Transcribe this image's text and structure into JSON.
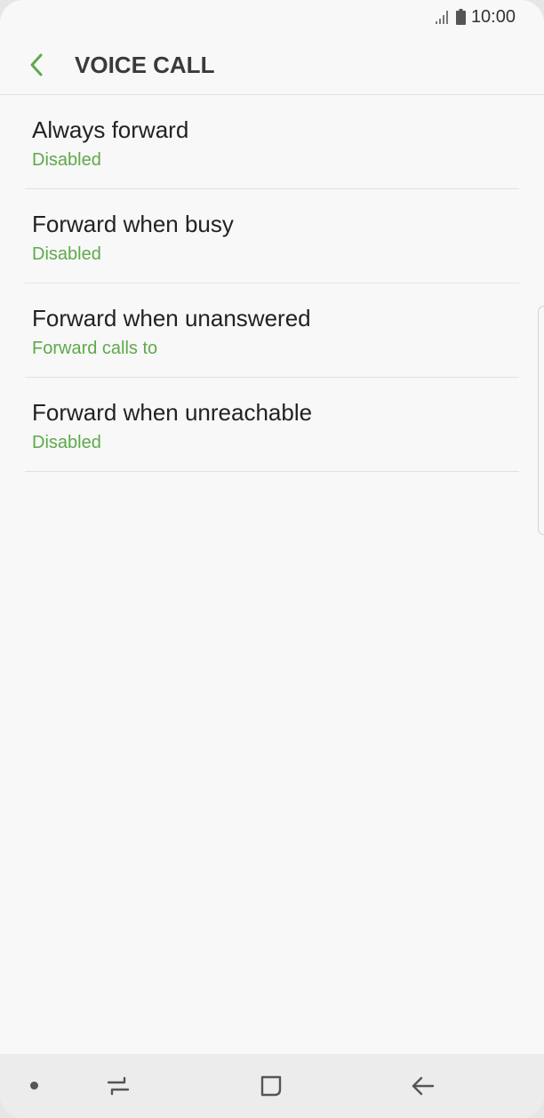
{
  "status_bar": {
    "time": "10:00",
    "icons": [
      "signal-icon",
      "battery-icon"
    ]
  },
  "header": {
    "back_icon": "chevron-left-icon",
    "title": "VOICE CALL"
  },
  "items": [
    {
      "title": "Always forward",
      "subtitle": "Disabled"
    },
    {
      "title": "Forward when busy",
      "subtitle": "Disabled"
    },
    {
      "title": "Forward when unanswered",
      "subtitle": "Forward calls to"
    },
    {
      "title": "Forward when unreachable",
      "subtitle": "Disabled"
    }
  ],
  "nav_bar": {
    "icons": [
      "nav-dot-icon",
      "recent-apps-icon",
      "home-icon",
      "back-arrow-icon"
    ]
  },
  "colors": {
    "accent": "#5ea94a",
    "background": "#f8f8f8",
    "nav_background": "#ececec",
    "text_primary": "#222222"
  }
}
